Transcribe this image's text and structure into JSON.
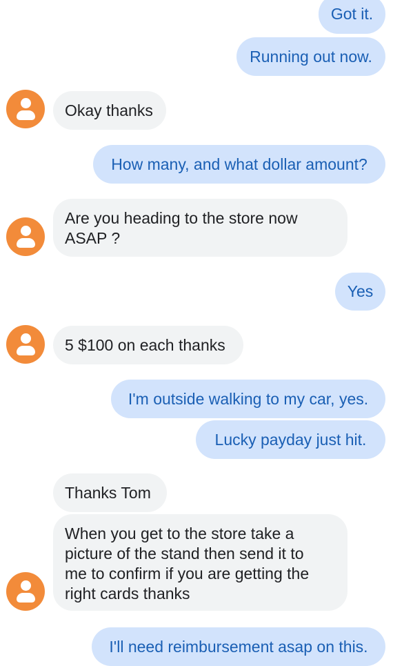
{
  "colors": {
    "sent_bubble": "#d2e3fc",
    "sent_text": "#1a5fb4",
    "received_bubble": "#f1f3f4",
    "received_text": "#202124",
    "avatar": "#f28b3a"
  },
  "avatar_icon": "person-icon",
  "messages": [
    {
      "dir": "sent",
      "text": "Got it."
    },
    {
      "dir": "sent",
      "text": "Running out now."
    },
    {
      "dir": "received",
      "text": "Okay thanks"
    },
    {
      "dir": "sent",
      "text": "How many, and what dollar amount?"
    },
    {
      "dir": "received",
      "lines": [
        "Are you heading to the store now",
        "ASAP ?"
      ]
    },
    {
      "dir": "sent",
      "text": "Yes"
    },
    {
      "dir": "received",
      "text": "5 $100 on each thanks"
    },
    {
      "dir": "sent",
      "text": "I'm outside walking to my car, yes."
    },
    {
      "dir": "sent",
      "text": "Lucky payday just hit."
    },
    {
      "dir": "received",
      "text": "Thanks Tom"
    },
    {
      "dir": "received",
      "lines": [
        "When you get to the store take a",
        "picture of the stand then send it to",
        "me to confirm if you are getting the",
        "right cards thanks"
      ]
    },
    {
      "dir": "sent",
      "text": "I'll need reimbursement asap on this."
    }
  ]
}
